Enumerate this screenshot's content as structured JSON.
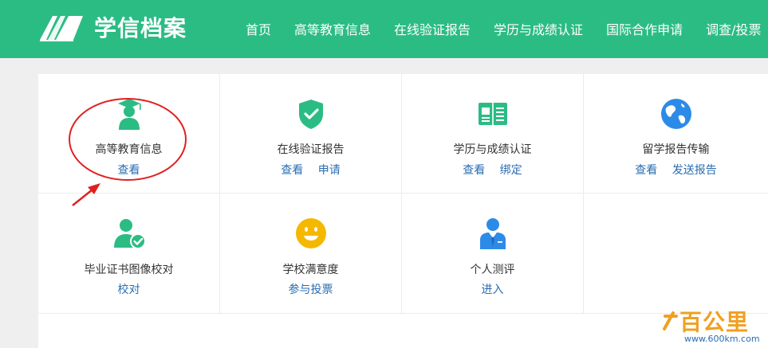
{
  "header": {
    "logo_text": "学信档案",
    "nav": [
      "首页",
      "高等教育信息",
      "在线验证报告",
      "学历与成绩认证",
      "国际合作申请",
      "调查/投票"
    ]
  },
  "cards": [
    {
      "title": "高等教育信息",
      "links": [
        "查看"
      ],
      "icon": "graduate-icon"
    },
    {
      "title": "在线验证报告",
      "links": [
        "查看",
        "申请"
      ],
      "icon": "shield-check-icon"
    },
    {
      "title": "学历与成绩认证",
      "links": [
        "查看",
        "绑定"
      ],
      "icon": "book-icon"
    },
    {
      "title": "留学报告传输",
      "links": [
        "查看",
        "发送报告"
      ],
      "icon": "globe-icon"
    },
    {
      "title": "毕业证书图像校对",
      "links": [
        "校对"
      ],
      "icon": "user-check-icon"
    },
    {
      "title": "学校满意度",
      "links": [
        "参与投票"
      ],
      "icon": "smiley-icon"
    },
    {
      "title": "个人测评",
      "links": [
        "进入"
      ],
      "icon": "person-tie-icon"
    }
  ],
  "colors": {
    "brand_green": "#2bbc84",
    "link_blue": "#2a6db2",
    "icon_blue": "#2d8be8",
    "icon_yellow": "#f5b800",
    "annotation_red": "#e02020"
  },
  "watermark": {
    "name": "百公里",
    "url": "www.600km.com"
  }
}
